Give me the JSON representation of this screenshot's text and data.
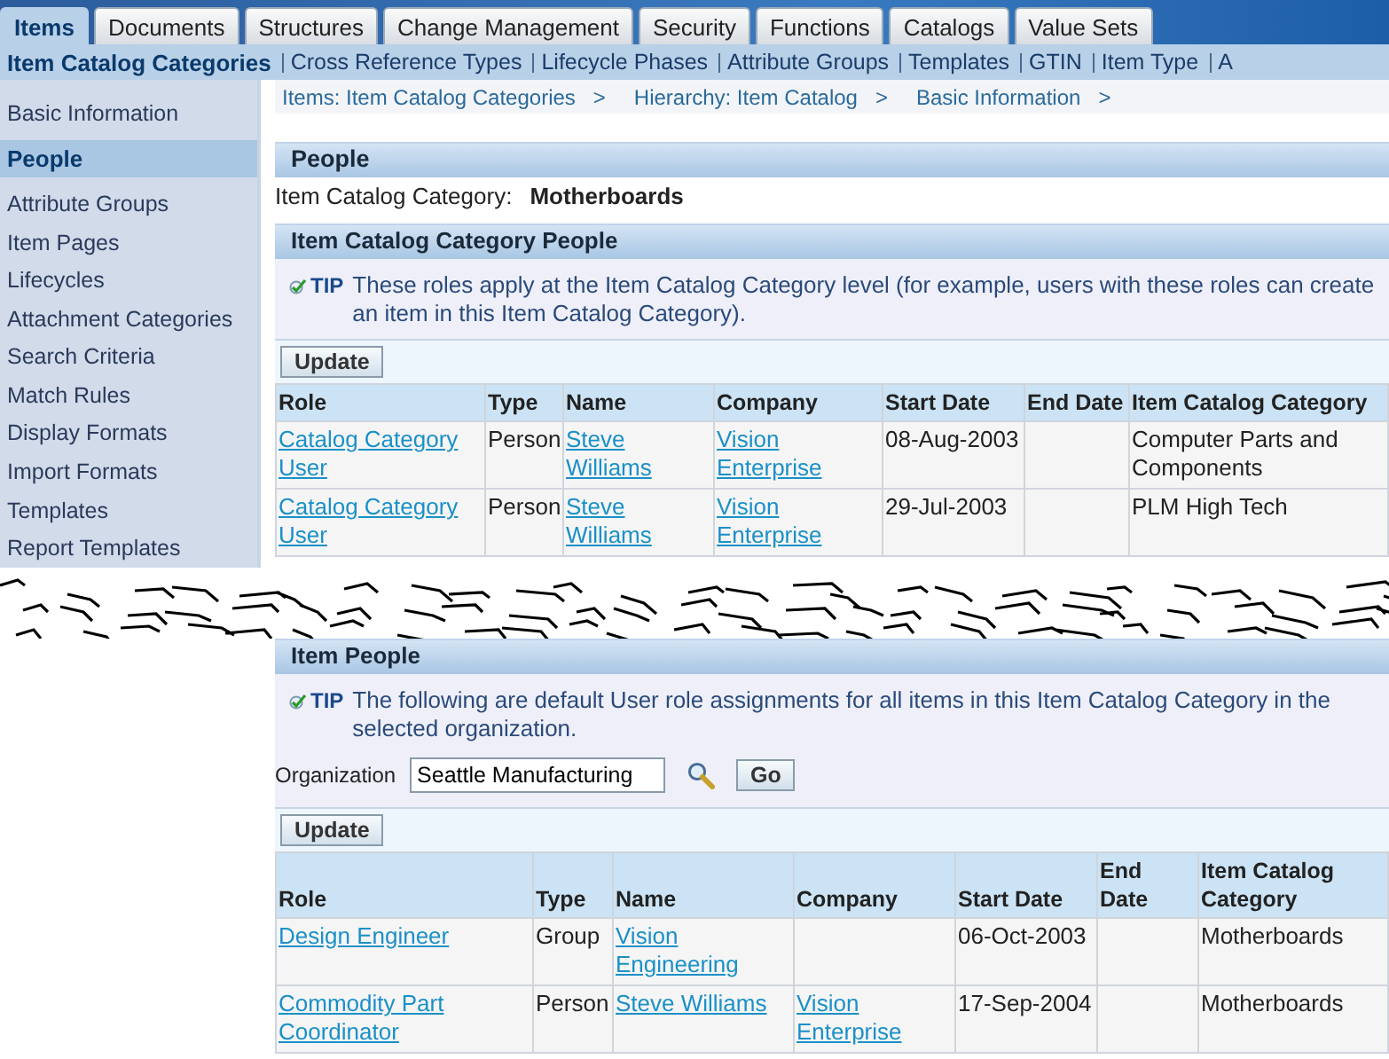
{
  "tabs": [
    {
      "label": "Items",
      "selected": true
    },
    {
      "label": "Documents",
      "selected": false
    },
    {
      "label": "Structures",
      "selected": false
    },
    {
      "label": "Change Management",
      "selected": false
    },
    {
      "label": "Security",
      "selected": false
    },
    {
      "label": "Functions",
      "selected": false
    },
    {
      "label": "Catalogs",
      "selected": false
    },
    {
      "label": "Value Sets",
      "selected": false
    }
  ],
  "subtabs": [
    {
      "label": "Item Catalog Categories",
      "selected": true
    },
    {
      "label": "Cross Reference Types",
      "selected": false
    },
    {
      "label": "Lifecycle Phases",
      "selected": false
    },
    {
      "label": "Attribute Groups",
      "selected": false
    },
    {
      "label": "Templates",
      "selected": false
    },
    {
      "label": "GTIN",
      "selected": false
    },
    {
      "label": "Item Type",
      "selected": false
    },
    {
      "label": "A",
      "selected": false
    }
  ],
  "sidebar": {
    "items": [
      {
        "label": "Basic Information",
        "selected": false
      },
      {
        "label": "People",
        "selected": true
      },
      {
        "label": "Attribute Groups",
        "selected": false
      },
      {
        "label": "Item Pages",
        "selected": false
      },
      {
        "label": "Lifecycles",
        "selected": false
      },
      {
        "label": "Attachment Categories",
        "selected": false
      },
      {
        "label": "Search Criteria",
        "selected": false
      },
      {
        "label": "Match Rules",
        "selected": false
      },
      {
        "label": "Display Formats",
        "selected": false
      },
      {
        "label": "Import Formats",
        "selected": false
      },
      {
        "label": "Templates",
        "selected": false
      },
      {
        "label": "Report Templates",
        "selected": false
      }
    ]
  },
  "breadcrumbs": [
    {
      "label": "Items: Item Catalog Categories",
      "separator": ">"
    },
    {
      "label": "Hierarchy: Item Catalog",
      "separator": ">"
    },
    {
      "label": "Basic Information",
      "separator": ">"
    }
  ],
  "page_title": "People",
  "category_field": {
    "label": "Item Catalog Category:",
    "value": "Motherboards"
  },
  "category_people": {
    "title": "Item Catalog Category People",
    "tip_label": "TIP",
    "tip": "These roles apply at the Item Catalog Category level (for example, users with these roles can create an item in this Item Catalog Category).",
    "button": "Update",
    "columns": [
      "Role",
      "Type",
      "Name",
      "Company",
      "Start Date",
      "End Date",
      "Item Catalog Category"
    ],
    "rows": [
      [
        "Catalog Category User",
        "Person",
        "Steve Williams",
        "Vision Enterprise",
        "08-Aug-2003",
        "",
        "Computer Parts and Components"
      ],
      [
        "Catalog Category User",
        "Person",
        "Steve Williams",
        "Vision Enterprise",
        "29-Jul-2003",
        "",
        "PLM High Tech"
      ]
    ]
  },
  "item_people": {
    "title": "Item People",
    "tip_label": "TIP",
    "tip": "The following are default User role assignments for all items in this Item Catalog Category in the selected organization.",
    "organization_label": "Organization",
    "organization_value": "Seattle Manufacturing",
    "go_button": "Go",
    "button": "Update",
    "columns": [
      "Role",
      "Type",
      "Name",
      "Company",
      "Start Date",
      "End Date",
      "Item Catalog Category"
    ],
    "rows": [
      [
        "Design Engineer",
        "Group",
        "Vision Engineering",
        "",
        "06-Oct-2003",
        "",
        "Motherboards"
      ],
      [
        "Commodity Part Coordinator",
        "Person",
        "Steve Williams",
        "Vision Enterprise",
        "17-Sep-2004",
        "",
        "Motherboards"
      ]
    ]
  }
}
